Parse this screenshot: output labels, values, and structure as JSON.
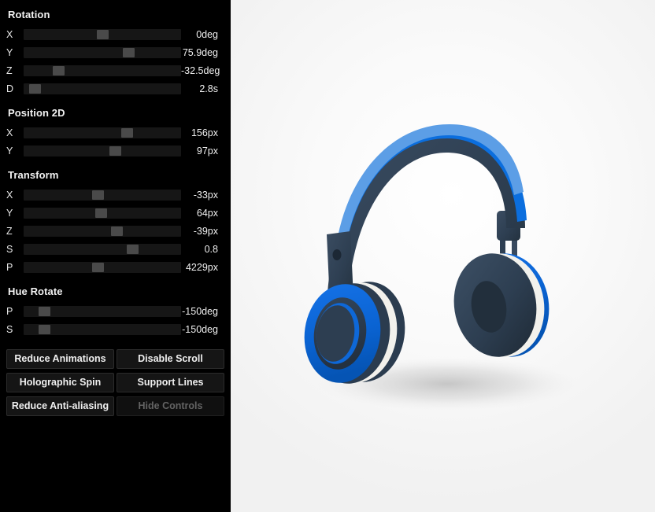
{
  "panel": {
    "sections": [
      {
        "name": "rotation",
        "title": "Rotation",
        "sliders": [
          {
            "label": "X",
            "value": "0deg",
            "pos": 50
          },
          {
            "label": "Y",
            "value": "75.9deg",
            "pos": 68
          },
          {
            "label": "Z",
            "value": "-32.5deg",
            "pos": 20
          },
          {
            "label": "D",
            "value": "2.8s",
            "pos": 4
          }
        ]
      },
      {
        "name": "position-2d",
        "title": "Position 2D",
        "sliders": [
          {
            "label": "X",
            "value": "156px",
            "pos": 67
          },
          {
            "label": "Y",
            "value": "97px",
            "pos": 59
          }
        ]
      },
      {
        "name": "transform",
        "title": "Transform",
        "sliders": [
          {
            "label": "X",
            "value": "-33px",
            "pos": 47
          },
          {
            "label": "Y",
            "value": "64px",
            "pos": 49
          },
          {
            "label": "Z",
            "value": "-39px",
            "pos": 60
          },
          {
            "label": "S",
            "value": "0.8",
            "pos": 71
          },
          {
            "label": "P",
            "value": "4229px",
            "pos": 47
          }
        ]
      },
      {
        "name": "hue-rotate",
        "title": "Hue Rotate",
        "sliders": [
          {
            "label": "P",
            "value": "-150deg",
            "pos": 10
          },
          {
            "label": "S",
            "value": "-150deg",
            "pos": 10
          }
        ]
      }
    ],
    "buttons": [
      {
        "name": "reduce-animations",
        "label": "Reduce Animations",
        "disabled": false
      },
      {
        "name": "disable-scroll",
        "label": "Disable Scroll",
        "disabled": false
      },
      {
        "name": "holographic-spin",
        "label": "Holographic Spin",
        "disabled": false
      },
      {
        "name": "support-lines",
        "label": "Support Lines",
        "disabled": false
      },
      {
        "name": "reduce-anti-aliasing",
        "label": "Reduce Anti-aliasing",
        "disabled": false
      },
      {
        "name": "hide-controls",
        "label": "Hide Controls",
        "disabled": true
      }
    ]
  },
  "stage": {
    "product": "headphones-3d-render",
    "colors": {
      "headband_highlight": "#5c9ee6",
      "headband_accent": "#0b6ede",
      "headband_dark": "#2e3f52",
      "earcup_blue": "#0a63d2",
      "earcup_navy": "#2b3c4f",
      "earcup_inner": "#24323f",
      "earcup_white": "#f2f1ec",
      "shadow": "#c9c9c9",
      "background": "#f5f5f5"
    }
  }
}
